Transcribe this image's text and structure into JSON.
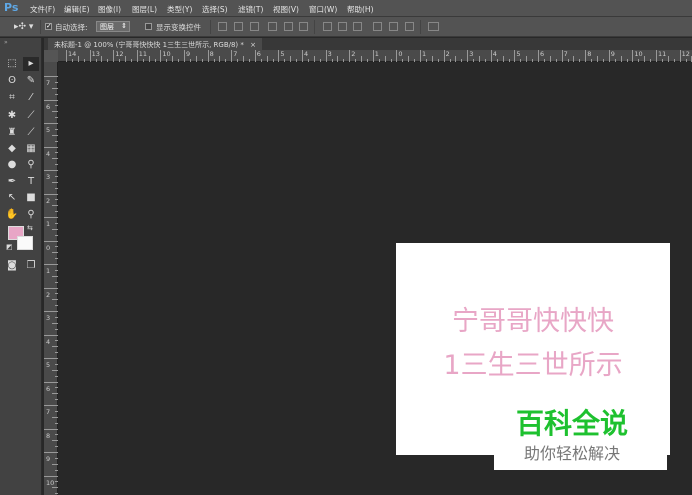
{
  "app": {
    "logo": "Ps"
  },
  "menu": [
    "文件(F)",
    "编辑(E)",
    "图像(I)",
    "图层(L)",
    "类型(Y)",
    "选择(S)",
    "滤镜(T)",
    "视图(V)",
    "窗口(W)",
    "帮助(H)"
  ],
  "options": {
    "auto_select_label": "自动选择:",
    "auto_select_checked": true,
    "auto_select_value": "图层",
    "show_transform_label": "显示变换控件",
    "show_transform_checked": false
  },
  "document_tab": {
    "title": "未标题-1 @ 100% (宁哥哥快快快 1三生三世所示, RGB/8) *",
    "close": "×"
  },
  "hruler": [
    "14",
    "13",
    "12",
    "11",
    "10",
    "9",
    "8",
    "7",
    "6",
    "5",
    "4",
    "3",
    "2",
    "1",
    "0",
    "1",
    "2",
    "3",
    "4",
    "5",
    "6",
    "7",
    "8",
    "9",
    "10",
    "11",
    "12"
  ],
  "vruler": [
    "7",
    "6",
    "5",
    "4",
    "3",
    "2",
    "1",
    "0",
    "1",
    "2",
    "3",
    "4",
    "5",
    "6",
    "7",
    "8",
    "9",
    "10"
  ],
  "colors": {
    "foreground": "#e8a6c6",
    "background": "#fafafa"
  },
  "canvas": {
    "line1": "宁哥哥快快快",
    "line2": "1三生三世所示",
    "text_color": "#e8a6c6"
  },
  "watermark": {
    "title": "百科全说",
    "subtitle": "助你轻松解决"
  }
}
